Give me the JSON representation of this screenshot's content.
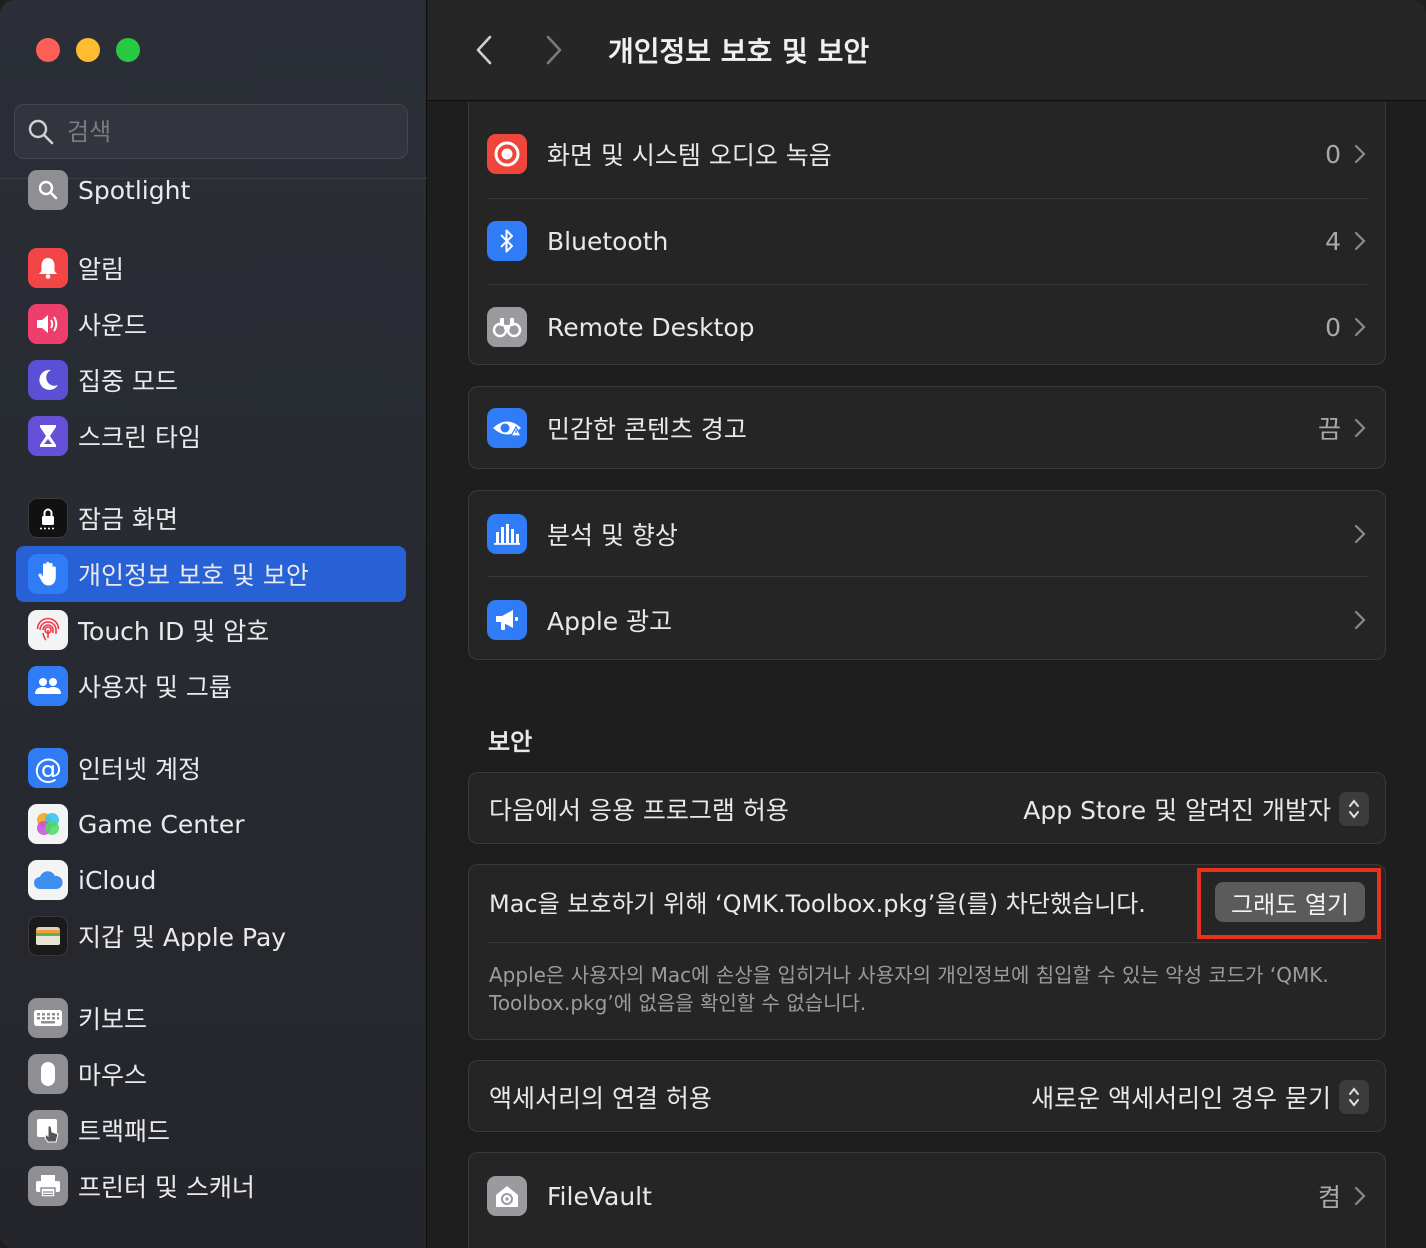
{
  "window": {
    "title": "개인정보 보호 및 보안"
  },
  "search": {
    "placeholder": "검색"
  },
  "sidebar": {
    "items": [
      {
        "label": "Spotlight",
        "icon": "spotlight-icon",
        "color": "#8e8e93"
      },
      {
        "label": "알림",
        "icon": "bell-icon",
        "color": "#f24646"
      },
      {
        "label": "사운드",
        "icon": "speaker-icon",
        "color": "#ee3e6c"
      },
      {
        "label": "집중 모드",
        "icon": "moon-icon",
        "color": "#5b4fd6"
      },
      {
        "label": "스크린 타임",
        "icon": "hourglass-icon",
        "color": "#6650d8"
      },
      {
        "label": "잠금 화면",
        "icon": "lock-screen-icon",
        "color": "#111111"
      },
      {
        "label": "개인정보 보호 및 보안",
        "icon": "hand-icon",
        "color": "#2f7cf6"
      },
      {
        "label": "Touch ID 및 암호",
        "icon": "fingerprint-icon",
        "color": "#f4f4f4"
      },
      {
        "label": "사용자 및 그룹",
        "icon": "users-icon",
        "color": "#2f7cf6"
      },
      {
        "label": "인터넷 계정",
        "icon": "at-icon",
        "color": "#2f7cf6"
      },
      {
        "label": "Game Center",
        "icon": "game-center-icon",
        "color": "#f4f4f4"
      },
      {
        "label": "iCloud",
        "icon": "cloud-icon",
        "color": "#f4f4f4"
      },
      {
        "label": "지갑 및 Apple Pay",
        "icon": "wallet-icon",
        "color": "#1a1a1a"
      },
      {
        "label": "키보드",
        "icon": "keyboard-icon",
        "color": "#8e8e93"
      },
      {
        "label": "마우스",
        "icon": "mouse-icon",
        "color": "#8e8e93"
      },
      {
        "label": "트랙패드",
        "icon": "trackpad-icon",
        "color": "#8e8e93"
      },
      {
        "label": "프린터 및 스캐너",
        "icon": "printer-icon",
        "color": "#8e8e93"
      }
    ]
  },
  "privacy": {
    "screen_recording": {
      "label": "화면 및 시스템 오디오 녹음",
      "value": "0",
      "icon": "record-icon"
    },
    "bluetooth": {
      "label": "Bluetooth",
      "value": "4",
      "icon": "bluetooth-icon"
    },
    "remote_desktop": {
      "label": "Remote Desktop",
      "value": "0",
      "icon": "binoculars-icon"
    },
    "sensitive_content": {
      "label": "민감한 콘텐츠 경고",
      "value": "끔",
      "icon": "eye-warning-icon"
    },
    "analytics": {
      "label": "분석 및 향상",
      "icon": "chart-icon"
    },
    "apple_ads": {
      "label": "Apple 광고",
      "icon": "megaphone-icon"
    }
  },
  "security": {
    "section_title": "보안",
    "allow_apps": {
      "label": "다음에서 응용 프로그램 허용",
      "value": "App Store 및 알려진 개발자"
    },
    "blocked": {
      "message": "Mac을 보호하기 위해 ‘QMK.Toolbox.pkg’을(를) 차단했습니다.",
      "button": "그래도 열기",
      "note": "Apple은 사용자의 Mac에 손상을 입히거나 사용자의 개인정보에 침입할 수 있는 악성 코드가 ‘QMK. Toolbox.pkg’에 없음을 확인할 수 없습니다."
    },
    "accessories": {
      "label": "액세서리의 연결 허용",
      "value": "새로운 액세서리인 경우 묻기"
    },
    "filevault": {
      "label": "FileVault",
      "value": "켬",
      "icon": "house-lock-icon"
    }
  },
  "colors": {
    "accent": "#2860d6",
    "highlight": "#e8321f"
  }
}
